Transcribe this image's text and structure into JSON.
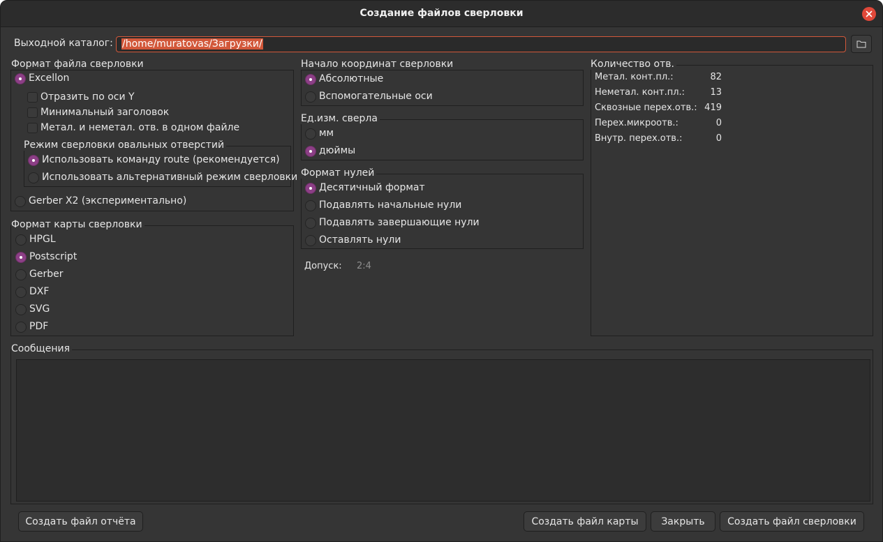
{
  "window": {
    "title": "Создание файлов сверловки"
  },
  "output_dir": {
    "label": "Выходной каталог:",
    "value": "/home/muratovas/Загрузки/"
  },
  "drill_format": {
    "title": "Формат файла сверловки",
    "excellon": "Excellon",
    "mirror_y": "Отразить по оси Y",
    "minimal_header": "Минимальный заголовок",
    "merge_pth_npth": "Метал. и неметал. отв. в одном файле",
    "oval_mode": {
      "title": "Режим сверловки овальных отверстий",
      "route": "Использовать команду route (рекомендуется)",
      "alternate": "Использовать альтернативный режим сверловки"
    },
    "gerber_x2": "Gerber X2 (экспериментально)"
  },
  "map_format": {
    "title": "Формат карты сверловки",
    "options": [
      "HPGL",
      "Postscript",
      "Gerber",
      "DXF",
      "SVG",
      "PDF"
    ],
    "selected": "Postscript"
  },
  "origin": {
    "title": "Начало координат сверловки",
    "absolute": "Абсолютные",
    "aux": "Вспомогательные оси"
  },
  "units": {
    "title": "Ед.изм. сверла",
    "mm": "мм",
    "inches": "дюймы"
  },
  "zeros": {
    "title": "Формат нулей",
    "decimal": "Десятичный формат",
    "suppress_leading": "Подавлять начальные нули",
    "suppress_trailing": "Подавлять завершающие нули",
    "keep": "Оставлять нули"
  },
  "precision": {
    "label": "Допуск:",
    "value": "2:4"
  },
  "hole_counts": {
    "title": "Количество отв.",
    "rows": [
      {
        "label": "Метал. конт.пл.:",
        "value": "82"
      },
      {
        "label": "Неметал. конт.пл.:",
        "value": "13"
      },
      {
        "label": "Сквозные перех.отв.:",
        "value": "419"
      },
      {
        "label": "Перех.микроотв.:",
        "value": "0"
      },
      {
        "label": "Внутр. перех.отв.:",
        "value": "0"
      }
    ]
  },
  "messages": {
    "title": "Сообщения"
  },
  "buttons": {
    "report": "Создать файл отчёта",
    "map": "Создать файл карты",
    "close": "Закрыть",
    "drill": "Создать файл сверловки"
  },
  "colors": {
    "accent": "#8c3f86",
    "selection": "#d2583a",
    "close": "#e0483a",
    "background": "#353535"
  }
}
